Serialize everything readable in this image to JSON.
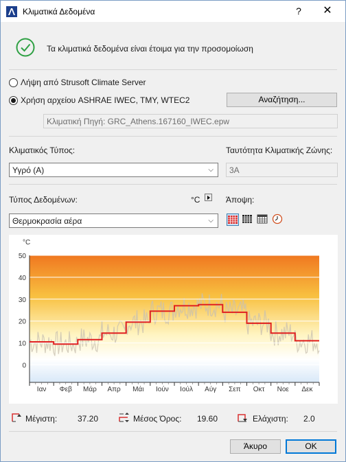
{
  "window": {
    "title": "Κλιματικά Δεδομένα",
    "help": "?",
    "close": "✕"
  },
  "status": {
    "icon": "check-circle-icon",
    "message": "Τα κλιματικά δεδομένα είναι έτοιμα για την προσομοίωση",
    "color": "#2ea043"
  },
  "source": {
    "option_server": "Λήψη από Strusoft Climate Server",
    "option_file": "Χρήση αρχείου ASHRAE IWEC, TMY, WTEC2",
    "selected": "file",
    "browse_label": "Αναζήτηση...",
    "source_path": "Κλιματική Πηγή: GRC_Athens.167160_IWEC.epw"
  },
  "climate": {
    "type_label": "Κλιματικός Τύπος:",
    "type_value": "Υγρό (A)",
    "zone_label": "Ταυτότητα Κλιματικής Ζώνης:",
    "zone_value": "3A"
  },
  "data_type": {
    "label": "Τύπος Δεδομένων:",
    "unit": "°C",
    "value": "Θερμοκρασία αέρα",
    "view_label": "Άποψη:",
    "views": [
      "grid-red-icon",
      "grid-dark-icon",
      "grid-light-icon",
      "clock-icon"
    ],
    "active_view": 0
  },
  "chart_data": {
    "type": "line",
    "ylabel": "°C",
    "ylim": [
      -8,
      50
    ],
    "yticks": [
      0,
      10,
      20,
      30,
      40,
      50
    ],
    "categories": [
      "Ιαν",
      "Φεβ",
      "Μάρ",
      "Απρ",
      "Μάι",
      "Ιούν",
      "Ιούλ",
      "Αύγ",
      "Σεπ",
      "Οκτ",
      "Νοε",
      "Δεκ"
    ],
    "series": [
      {
        "values": [
          10.5,
          9.5,
          11.5,
          14.5,
          19.5,
          24.5,
          27,
          27.5,
          24,
          19,
          14.5,
          11
        ]
      }
    ],
    "series_color": "#e02020",
    "gradient": [
      "#f07820",
      "#f8c040",
      "#fff4c0",
      "#ffffff",
      "#d8e8f8"
    ],
    "grid": true
  },
  "stats": {
    "max_label": "Μέγιστη:",
    "max_value": "37.20",
    "mean_label": "Μέσος Όρος:",
    "mean_value": "19.60",
    "min_label": "Ελάχιστη:",
    "min_value": "2.0"
  },
  "footer": {
    "cancel": "Άκυρο",
    "ok": "OK"
  }
}
